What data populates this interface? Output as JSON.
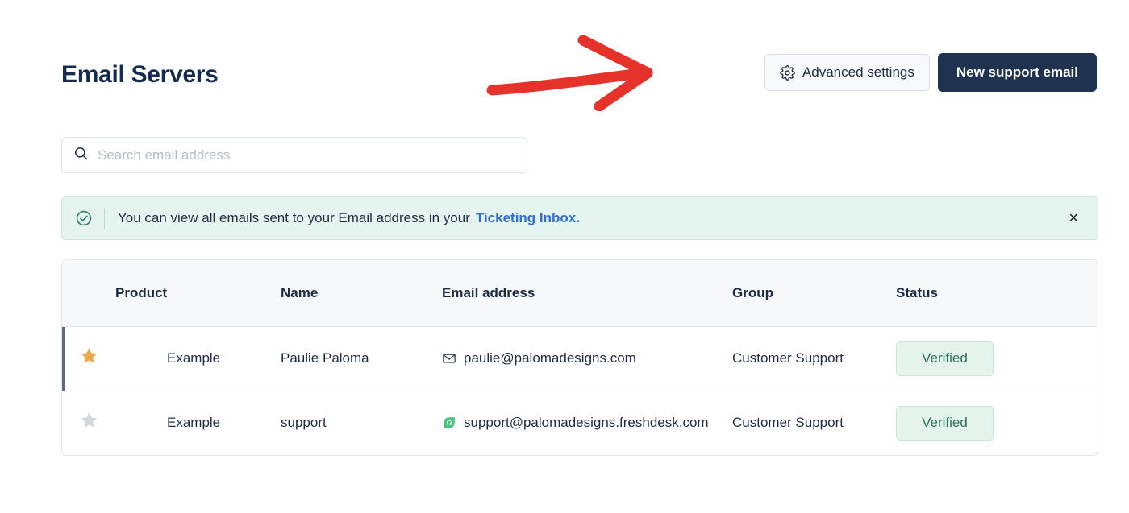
{
  "header": {
    "title": "Email Servers",
    "advanced_settings_label": "Advanced settings",
    "new_support_email_label": "New support email"
  },
  "search": {
    "placeholder": "Search email address",
    "value": ""
  },
  "banner": {
    "message": "You can view all emails sent to your Email address in your",
    "link_label": "Ticketing Inbox.",
    "close_label": "×"
  },
  "table": {
    "columns": [
      "Product",
      "Name",
      "Email address",
      "Group",
      "Status"
    ],
    "rows": [
      {
        "starred": true,
        "product": "Example",
        "name": "Paulie Paloma",
        "email": "paulie@palomadesigns.com",
        "email_icon": "envelope-icon",
        "group": "Customer Support",
        "status": "Verified"
      },
      {
        "starred": false,
        "product": "Example",
        "name": "support",
        "email": "support@palomadesigns.freshdesk.com",
        "email_icon": "freshdesk-icon",
        "group": "Customer Support",
        "status": "Verified"
      }
    ]
  },
  "annotation": {
    "type": "hand-drawn-arrow",
    "direction": "right",
    "color": "#e5322a",
    "points_to": "Advanced settings"
  },
  "colors": {
    "title": "#152c4e",
    "primary_button_bg": "#1f3350",
    "banner_bg": "#e5f4ee",
    "banner_link": "#2f6fd3",
    "badge_bg": "#e4f4ec",
    "badge_text": "#2c7553",
    "star_active": "#efa94c",
    "star_inactive": "#d3d7db",
    "freshdesk_green": "#4cc17e",
    "annotation_red": "#e5322a"
  }
}
